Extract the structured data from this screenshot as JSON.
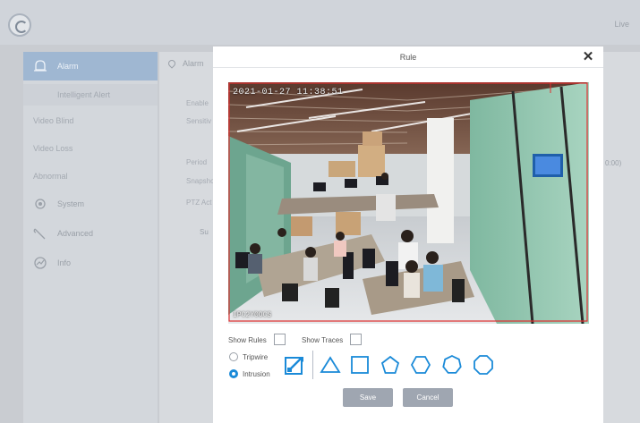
{
  "topbar": {
    "live_label": "Live"
  },
  "sidebar": {
    "items": [
      {
        "label": "Alarm",
        "icon": "bell-icon",
        "active": true
      },
      {
        "label": "System",
        "icon": "gear-icon"
      },
      {
        "label": "Advanced",
        "icon": "wrench-icon"
      },
      {
        "label": "Info",
        "icon": "chart-icon"
      }
    ],
    "alarm_sub": [
      "Intelligent Alert",
      "Video Blind",
      "Video Loss",
      "Abnormal"
    ]
  },
  "background_form": {
    "breadcrumb": "Alarm",
    "labels": [
      "Enable",
      "Sensitiv",
      "Period",
      "Snapsho",
      "PTZ Act"
    ],
    "fragment_right": "0:00)",
    "fragment_left": "Su"
  },
  "modal": {
    "title": "Rule",
    "close_icon": "close-icon",
    "video": {
      "timestamp_top": "2021-01-27 11:38:51",
      "timestamp_bottom": "IPC2Y0OCS"
    },
    "show_rules_label": "Show Rules",
    "show_traces_label": "Show Traces",
    "rule_types": [
      {
        "label": "Tripwire",
        "selected": false
      },
      {
        "label": "Intrusion",
        "selected": true
      }
    ],
    "shapes": [
      "edit-shape-icon",
      "triangle-icon",
      "square-icon",
      "pentagon-icon",
      "hexagon-icon",
      "heptagon-icon",
      "octagon-icon"
    ],
    "save_label": "Save",
    "cancel_label": "Cancel"
  },
  "colors": {
    "accent": "#1a8ad8",
    "button": "#9fa6b1",
    "sidebar_active": "#9fb7d2",
    "rule_line": "#e03030"
  }
}
